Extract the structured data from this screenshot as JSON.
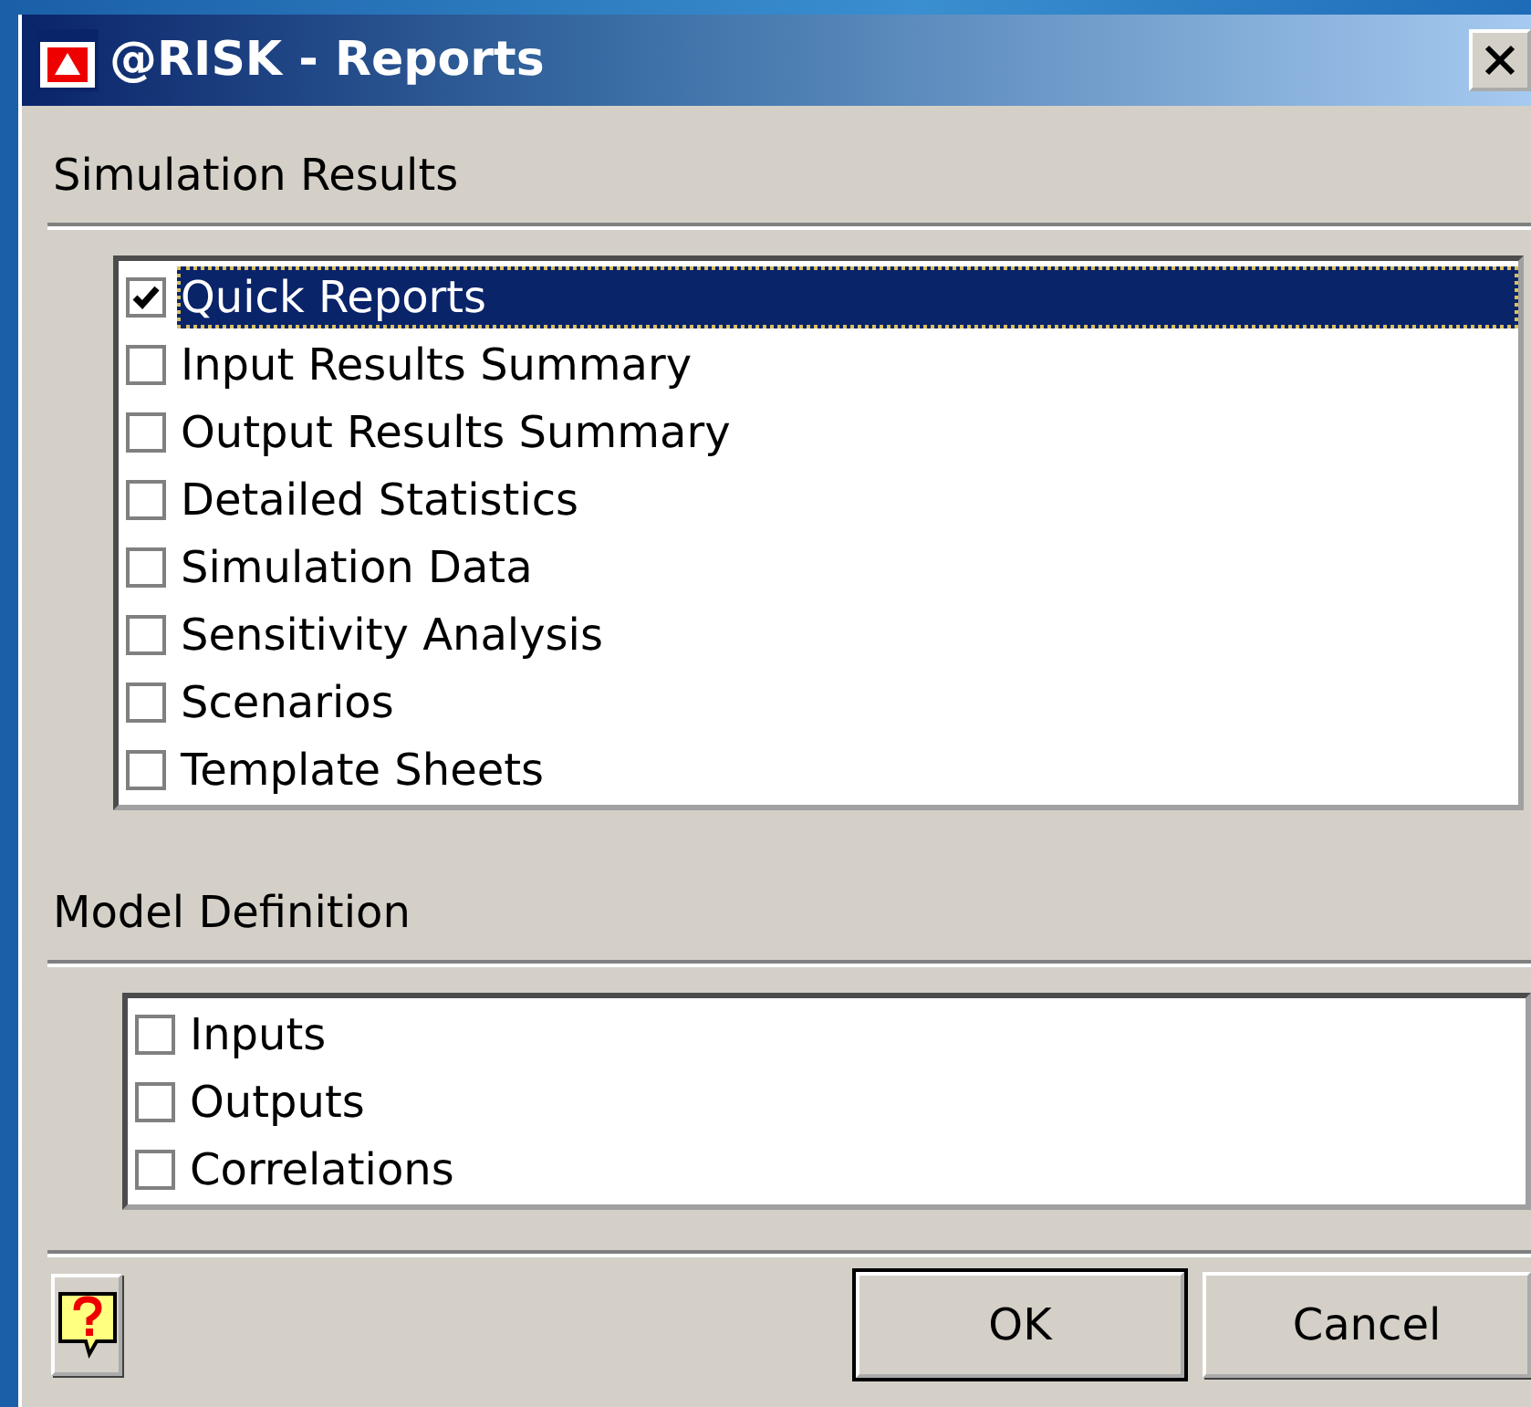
{
  "window": {
    "title": "@RISK - Reports"
  },
  "sections": [
    {
      "heading": "Simulation Results",
      "items": [
        {
          "label": "Quick Reports",
          "checked": true,
          "selected": true
        },
        {
          "label": "Input Results Summary",
          "checked": false,
          "selected": false
        },
        {
          "label": "Output Results Summary",
          "checked": false,
          "selected": false
        },
        {
          "label": "Detailed Statistics",
          "checked": false,
          "selected": false
        },
        {
          "label": "Simulation Data",
          "checked": false,
          "selected": false
        },
        {
          "label": "Sensitivity Analysis",
          "checked": false,
          "selected": false
        },
        {
          "label": "Scenarios",
          "checked": false,
          "selected": false
        },
        {
          "label": "Template Sheets",
          "checked": false,
          "selected": false
        }
      ]
    },
    {
      "heading": "Model Definition",
      "items": [
        {
          "label": "Inputs",
          "checked": false,
          "selected": false
        },
        {
          "label": "Outputs",
          "checked": false,
          "selected": false
        },
        {
          "label": "Correlations",
          "checked": false,
          "selected": false
        }
      ]
    }
  ],
  "buttons": [
    {
      "label": "OK",
      "default": true
    },
    {
      "label": "Cancel",
      "default": false
    }
  ]
}
